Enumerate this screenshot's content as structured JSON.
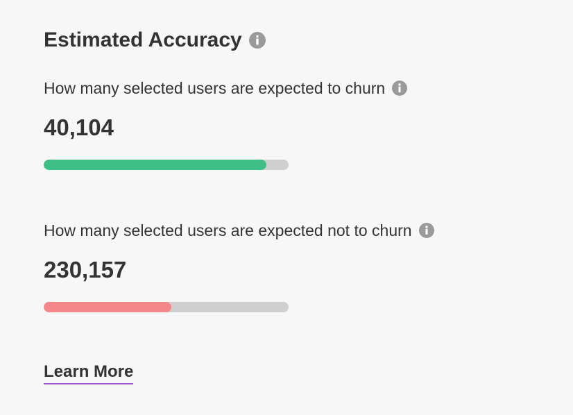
{
  "header": {
    "title": "Estimated Accuracy",
    "info_icon": "info-circle-icon"
  },
  "metrics": [
    {
      "label": "How many selected users are expected to churn",
      "value": "40,104",
      "progress": 0.91,
      "bar_color": "#3dbf85",
      "track_color": "#cfcfcf"
    },
    {
      "label": "How many selected users are expected not to churn",
      "value": "230,157",
      "progress": 0.52,
      "bar_color": "#f5878a",
      "track_color": "#cfcfcf"
    }
  ],
  "footer": {
    "learn_more_label": "Learn More",
    "underline_color": "#9b59d0"
  }
}
